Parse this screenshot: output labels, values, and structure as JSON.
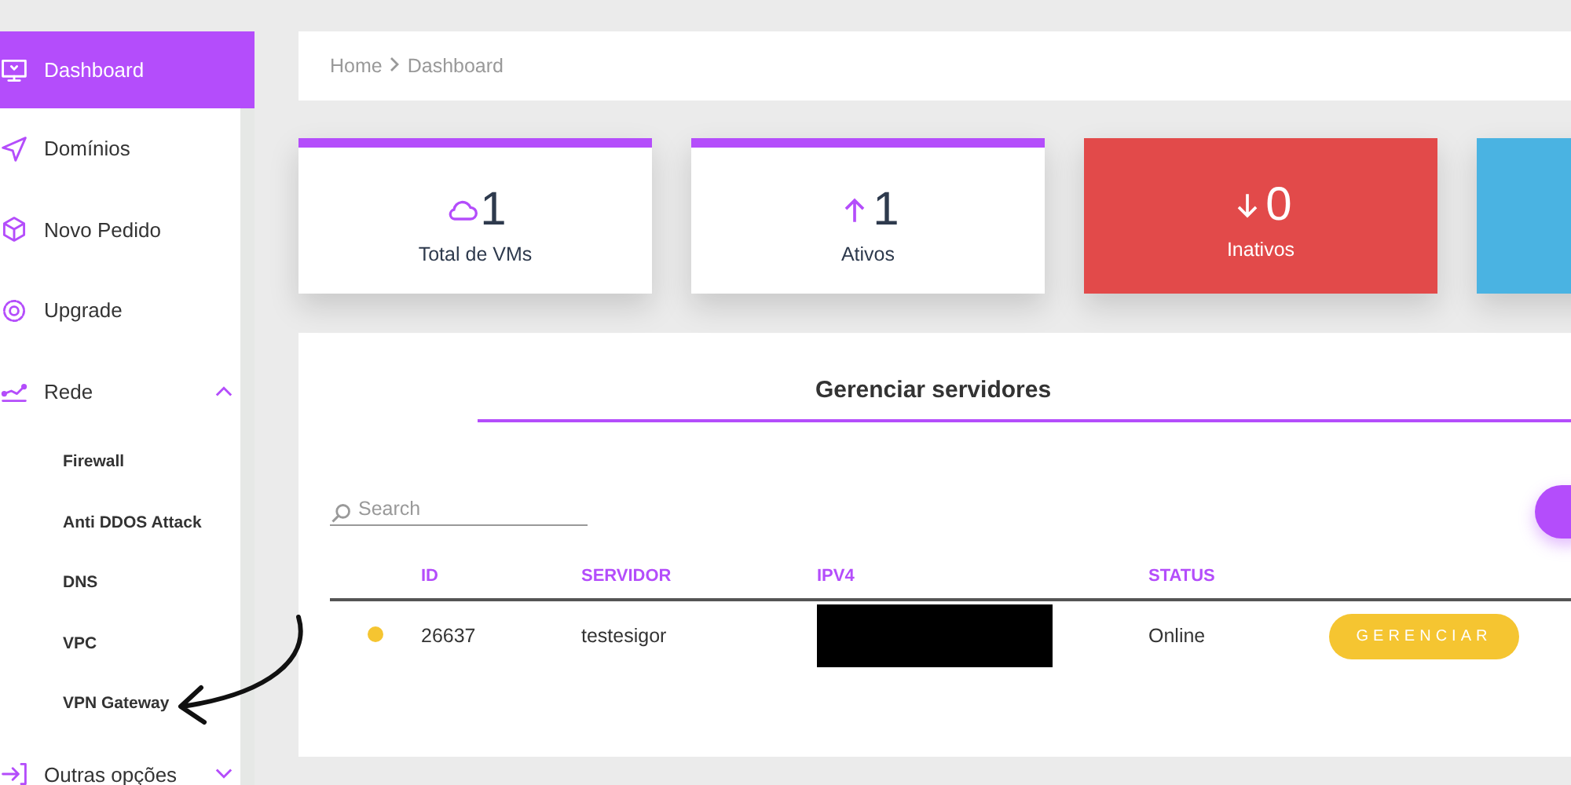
{
  "sidebar": {
    "items": [
      {
        "label": "Dashboard",
        "selected": true
      },
      {
        "label": "Domínios",
        "selected": false
      },
      {
        "label": "Novo Pedido",
        "selected": false
      },
      {
        "label": "Upgrade",
        "selected": false
      },
      {
        "label": "Rede",
        "selected": false,
        "expanded": true,
        "children": [
          {
            "label": "Firewall",
            "selected": false
          },
          {
            "label": "Anti DDOS Attack",
            "selected": false
          },
          {
            "label": "DNS",
            "selected": false
          },
          {
            "label": "VPC",
            "selected": false
          },
          {
            "label": "VPN Gateway",
            "selected": false
          }
        ]
      },
      {
        "label": "Outras opções",
        "selected": false,
        "expanded": false
      }
    ]
  },
  "breadcrumb": [
    "Home",
    "Dashboard"
  ],
  "cards": [
    {
      "kind": "outline",
      "color": "#b44dfb",
      "value": "1",
      "label": "Total de VMs"
    },
    {
      "kind": "outline",
      "color": "#b44dfb",
      "value": "1",
      "label": "Ativos"
    },
    {
      "kind": "filled",
      "color": "#e24a4a",
      "value": "0",
      "label": "Inativos"
    },
    {
      "kind": "filled",
      "color": "#4ab3e2"
    }
  ],
  "servers": {
    "title": "Gerenciar servidores",
    "search": {
      "placeholder": "Search"
    },
    "columns": [
      "ID",
      "SERVIDOR",
      "IPV4",
      "STATUS"
    ],
    "rows": [
      {
        "color": "#f5c531",
        "id": "26637",
        "name": "testesigor",
        "ipv4_redacted": true,
        "status": "Online",
        "action": "GERENCIAR"
      }
    ]
  }
}
